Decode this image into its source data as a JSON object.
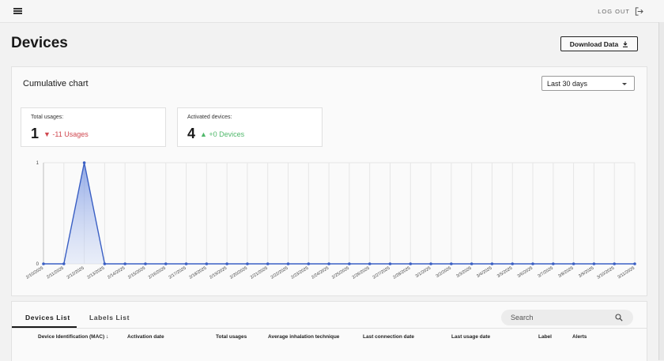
{
  "header": {
    "logout_label": "LOG OUT"
  },
  "page": {
    "title": "Devices",
    "download_label": "Download Data"
  },
  "chart_card": {
    "title": "Cumulative chart",
    "range": {
      "selected": "Last 30 days"
    }
  },
  "stats": {
    "usages": {
      "label": "Total usages:",
      "value": "1",
      "delta": "▼ -11 Usages"
    },
    "devices": {
      "label": "Activated devices:",
      "value": "4",
      "delta": "▲ +0 Devices"
    }
  },
  "chart_data": {
    "type": "area",
    "x": [
      "2/10/2025",
      "2/11/2025",
      "2/12/2025",
      "2/13/2025",
      "2/14/2025",
      "2/15/2025",
      "2/16/2025",
      "2/17/2025",
      "2/18/2025",
      "2/19/2025",
      "2/20/2025",
      "2/21/2025",
      "2/22/2025",
      "2/23/2025",
      "2/24/2025",
      "2/25/2025",
      "2/26/2025",
      "2/27/2025",
      "2/28/2025",
      "3/1/2025",
      "3/2/2025",
      "3/3/2025",
      "3/4/2025",
      "3/5/2025",
      "3/6/2025",
      "3/7/2025",
      "3/8/2025",
      "3/9/2025",
      "3/10/2025",
      "3/11/2025"
    ],
    "values": [
      0,
      0,
      1,
      0,
      0,
      0,
      0,
      0,
      0,
      0,
      0,
      0,
      0,
      0,
      0,
      0,
      0,
      0,
      0,
      0,
      0,
      0,
      0,
      0,
      0,
      0,
      0,
      0,
      0,
      0
    ],
    "ylim": [
      0,
      1
    ],
    "yticks": [
      "0",
      "1"
    ],
    "grid": true,
    "color": "#3a5fc4"
  },
  "devices_list": {
    "tabs": [
      {
        "label": "Devices List",
        "active": true
      },
      {
        "label": "Labels List",
        "active": false
      }
    ],
    "search_placeholder": "Search",
    "columns": [
      "Device Identification (MAC)",
      "Activation date",
      "Total usages",
      "Average inhalation technique",
      "Last connection date",
      "Last usage date",
      "Label",
      "Alerts"
    ],
    "sort_indicator": "↓"
  }
}
